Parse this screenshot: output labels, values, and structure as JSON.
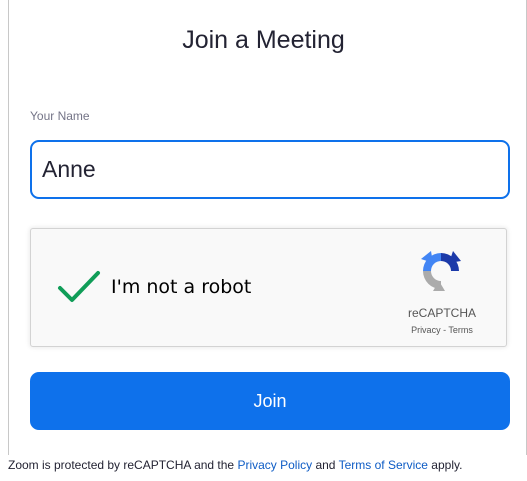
{
  "page": {
    "title": "Join a Meeting"
  },
  "name_field": {
    "label": "Your Name",
    "value": "Anne"
  },
  "recaptcha": {
    "checkbox_label": "I'm not a robot",
    "checked": true,
    "brand": "reCAPTCHA",
    "privacy_link": "Privacy",
    "separator": " - ",
    "terms_link": "Terms",
    "icons": [
      "checkmark-icon",
      "recaptcha-logo-icon"
    ]
  },
  "join_button": {
    "label": "Join"
  },
  "footer": {
    "text_before": "Zoom is protected by reCAPTCHA and the ",
    "privacy_link": "Privacy Policy",
    "text_middle": " and ",
    "terms_link": "Terms of Service",
    "text_after": " apply."
  },
  "colors": {
    "accent": "#0e71eb",
    "check_green": "#109d58",
    "link": "#0e5cc5"
  }
}
